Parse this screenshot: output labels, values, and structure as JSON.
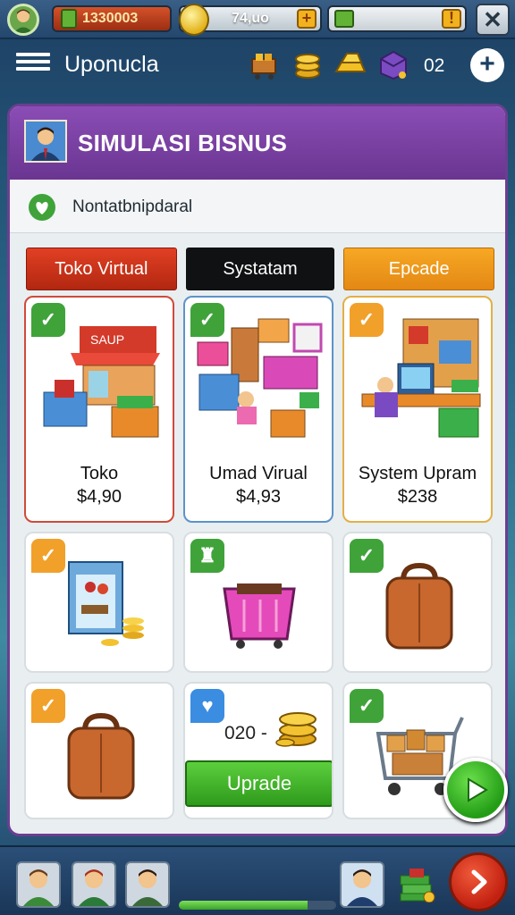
{
  "topbar": {
    "money": "1330003",
    "gems": "74,uo",
    "energy": ""
  },
  "header": {
    "title": "Uponucla",
    "count": "02"
  },
  "panel": {
    "title": "SIMULASI BISNUS",
    "subtitle": "Nontatbnipdaral"
  },
  "tabs": [
    {
      "label": "Toko Virtual"
    },
    {
      "label": "Systatam"
    },
    {
      "label": "Epcade"
    }
  ],
  "cards": [
    {
      "name": "Toko",
      "price": "$4,90",
      "icon": "store-stall-icon"
    },
    {
      "name": "Umad Virual",
      "price": "$4,93",
      "icon": "virtual-shop-icon"
    },
    {
      "name": "System Upram",
      "price": "$238",
      "icon": "computer-desk-icon"
    }
  ],
  "items": [
    {
      "icon": "fridge-coins-icon"
    },
    {
      "icon": "shopping-basket-icon"
    },
    {
      "icon": "brown-bag-icon"
    },
    {
      "icon": "brown-bag-icon"
    },
    {
      "icon": "coins-icon"
    },
    {
      "icon": "shopping-cart-icon"
    }
  ],
  "upgrade": {
    "amount": "020 -",
    "button_label": "Uprade"
  },
  "bottom": {
    "progress": 0.82
  },
  "colors": {
    "panel_header": "#7a42a6",
    "tab_red": "#d23418",
    "tab_black": "#0f1112",
    "tab_orange": "#f29a1e",
    "accent_green": "#3fa33a"
  }
}
